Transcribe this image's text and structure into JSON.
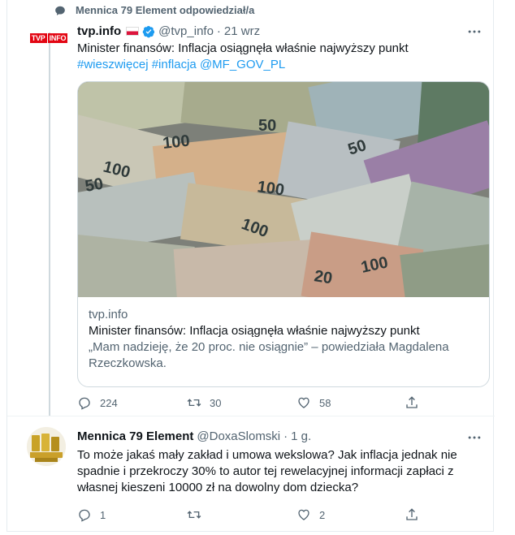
{
  "context": {
    "label": "Mennica 79 Element odpowiedział/a"
  },
  "tweet1": {
    "name": "tvp.info",
    "handle": "@tvp_info",
    "sep": "·",
    "time": "21 wrz",
    "logo": {
      "part1": "TVP",
      "part2": "INFO"
    },
    "text": "Minister finansów: Inflacja osiągnęła właśnie najwyższy punkt",
    "hashtags": [
      "#wieszwięcej",
      "#inflacja",
      "@MF_GOV_PL"
    ],
    "card": {
      "domain": "tvp.info",
      "title": "Minister finansów: Inflacja osiągnęła właśnie najwyższy punkt",
      "description": "„Mam nadzieję, że 20 proc. nie osiągnie” – powiedziała Magdalena Rzeczkowska.",
      "image_labels": [
        "100",
        "50",
        "100",
        "100",
        "50",
        "100",
        "20",
        "100",
        "50"
      ]
    },
    "actions": {
      "replies": "224",
      "retweets": "30",
      "likes": "58"
    }
  },
  "tweet2": {
    "name": "Mennica 79 Element",
    "handle": "@DoxaSlomski",
    "sep": "·",
    "time": "1 g.",
    "text": "To może jakaś mały zakład i umowa wekslowa? Jak inflacja jednak nie spadnie i przekroczy 30% to autor tej rewelacyjnej informacji zapłaci z własnej kieszeni 10000 zł na dowolny dom dziecka?",
    "actions": {
      "replies": "1",
      "retweets": "",
      "likes": "2"
    }
  },
  "colors": {
    "link": "#1d9bf0",
    "muted": "#536471",
    "brand_red": "#e30613"
  },
  "icons": [
    "retweet-icon",
    "more-icon",
    "verified-icon",
    "reply-icon",
    "like-icon",
    "share-icon"
  ]
}
